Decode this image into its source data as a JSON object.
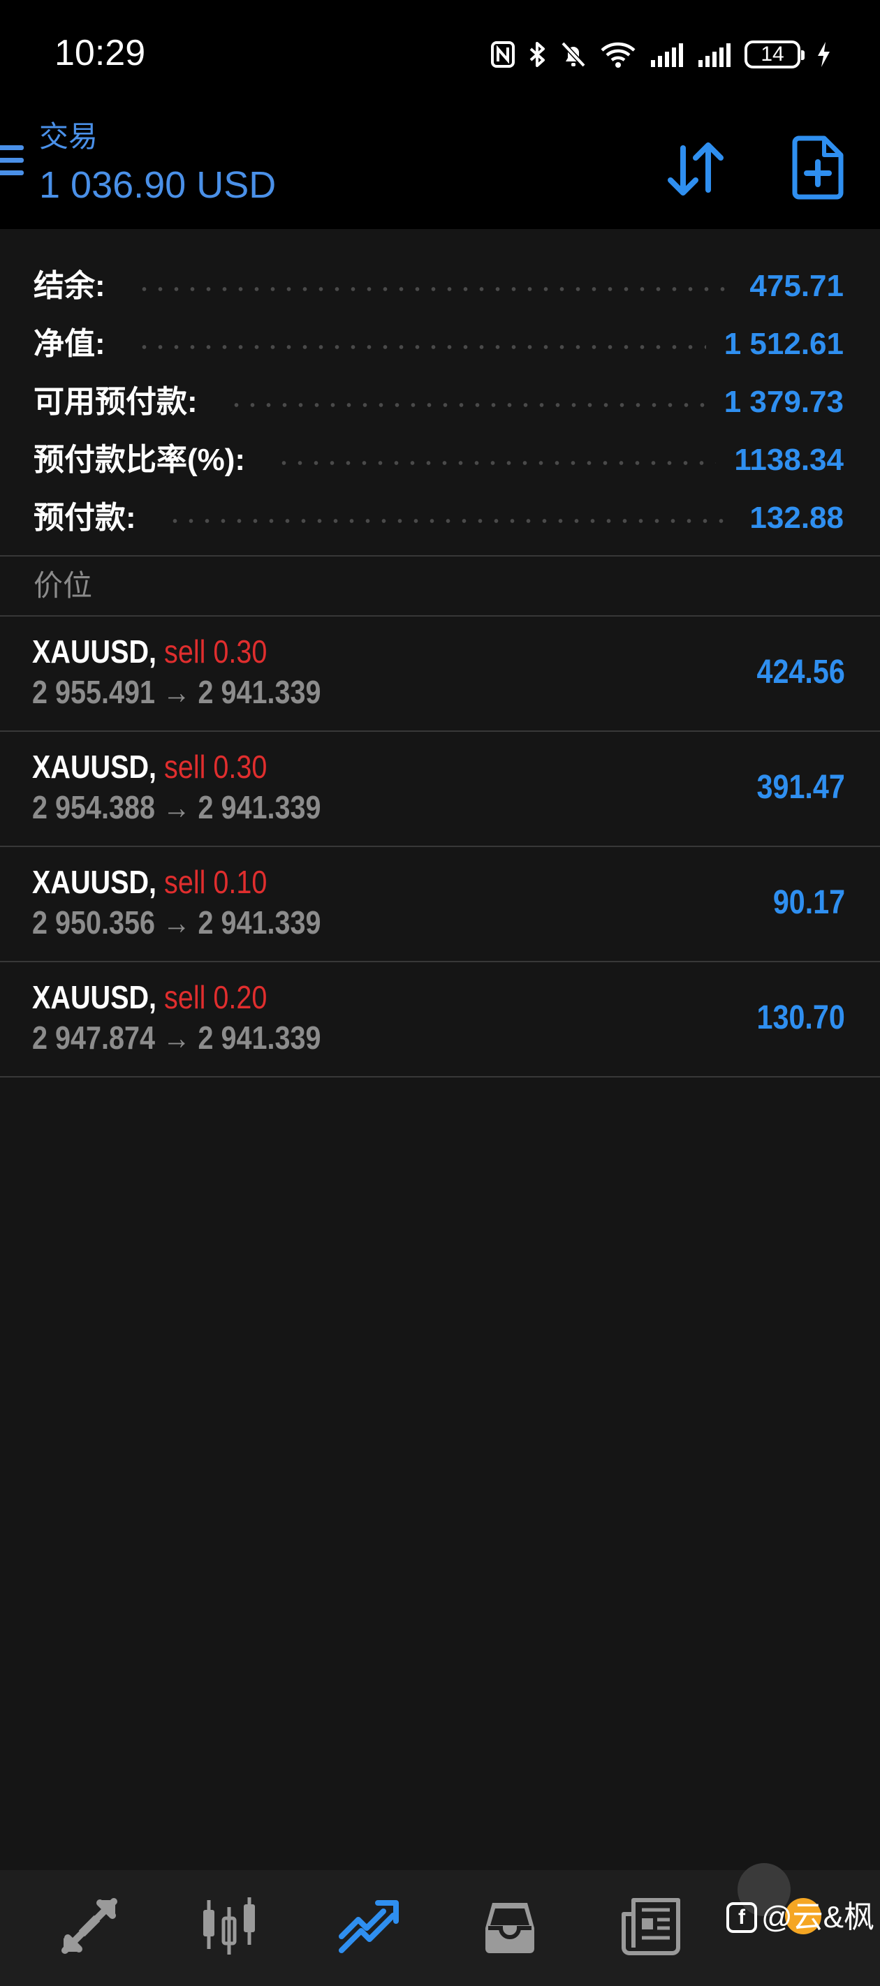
{
  "status_bar": {
    "time": "10:29",
    "battery": "14",
    "icons": [
      "nfc-icon",
      "bluetooth-icon",
      "mute-bell-icon",
      "wifi-icon",
      "signal-1-icon",
      "signal-2-icon",
      "battery-icon",
      "charging-icon"
    ]
  },
  "header": {
    "title": "交易",
    "subtitle": "1 036.90 USD"
  },
  "summary": [
    {
      "label": "结余:",
      "value": "475.71"
    },
    {
      "label": "净值:",
      "value": "1 512.61"
    },
    {
      "label": "可用预付款:",
      "value": "1 379.73"
    },
    {
      "label": "预付款比率(%):",
      "value": "1138.34"
    },
    {
      "label": "预付款:",
      "value": "132.88"
    }
  ],
  "positions_section": {
    "title": "价位"
  },
  "positions": [
    {
      "symbol": "XAUUSD,",
      "type": "sell 0.30",
      "prices": "2 955.491 → 2 941.339",
      "profit": "424.56"
    },
    {
      "symbol": "XAUUSD,",
      "type": "sell 0.30",
      "prices": "2 954.388 → 2 941.339",
      "profit": "391.47"
    },
    {
      "symbol": "XAUUSD,",
      "type": "sell 0.10",
      "prices": "2 950.356 → 2 941.339",
      "profit": "90.17"
    },
    {
      "symbol": "XAUUSD,",
      "type": "sell 0.20",
      "prices": "2 947.874 → 2 941.339",
      "profit": "130.70"
    }
  ],
  "bottom_nav": {
    "items": [
      "quotes-icon",
      "chart-icon",
      "trade-icon",
      "history-icon",
      "news-icon"
    ],
    "active": "trade-icon"
  },
  "watermark": {
    "text": "@云&枫"
  },
  "colors": {
    "accent": "#2f8ff0",
    "header_accent": "#4a90e8",
    "sell": "#e02e2e",
    "muted": "#8c8c8c",
    "background": "#151515"
  }
}
